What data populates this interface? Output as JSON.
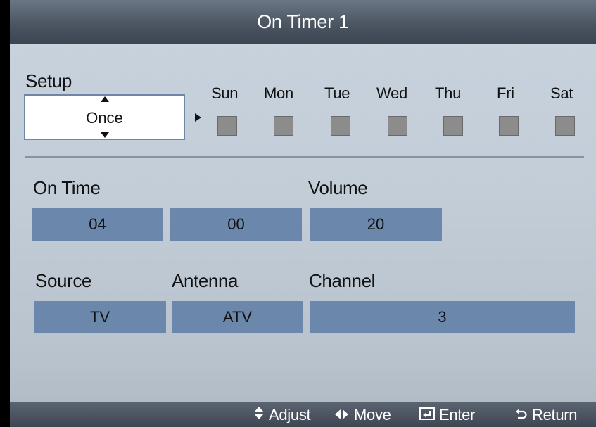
{
  "dialog": {
    "title": "On Timer 1"
  },
  "setup": {
    "label": "Setup",
    "value": "Once",
    "days": [
      "Sun",
      "Mon",
      "Tue",
      "Wed",
      "Thu",
      "Fri",
      "Sat"
    ]
  },
  "on_time": {
    "label": "On Time",
    "hour": "04",
    "minute": "00"
  },
  "volume": {
    "label": "Volume",
    "value": "20"
  },
  "source": {
    "label": "Source",
    "value": "TV"
  },
  "antenna": {
    "label": "Antenna",
    "value": "ATV"
  },
  "channel": {
    "label": "Channel",
    "value": "3"
  },
  "footer": {
    "adjust": "Adjust",
    "move": "Move",
    "enter": "Enter",
    "return": "Return"
  },
  "colors": {
    "field_fill": "#6b87ab",
    "checkbox_fill": "#8c8c8c",
    "title_bar": "#4c5663",
    "panel_bg": "#c3cdd8"
  },
  "icons": [
    "up-down-arrows-icon",
    "left-right-arrows-icon",
    "enter-icon",
    "return-icon"
  ]
}
